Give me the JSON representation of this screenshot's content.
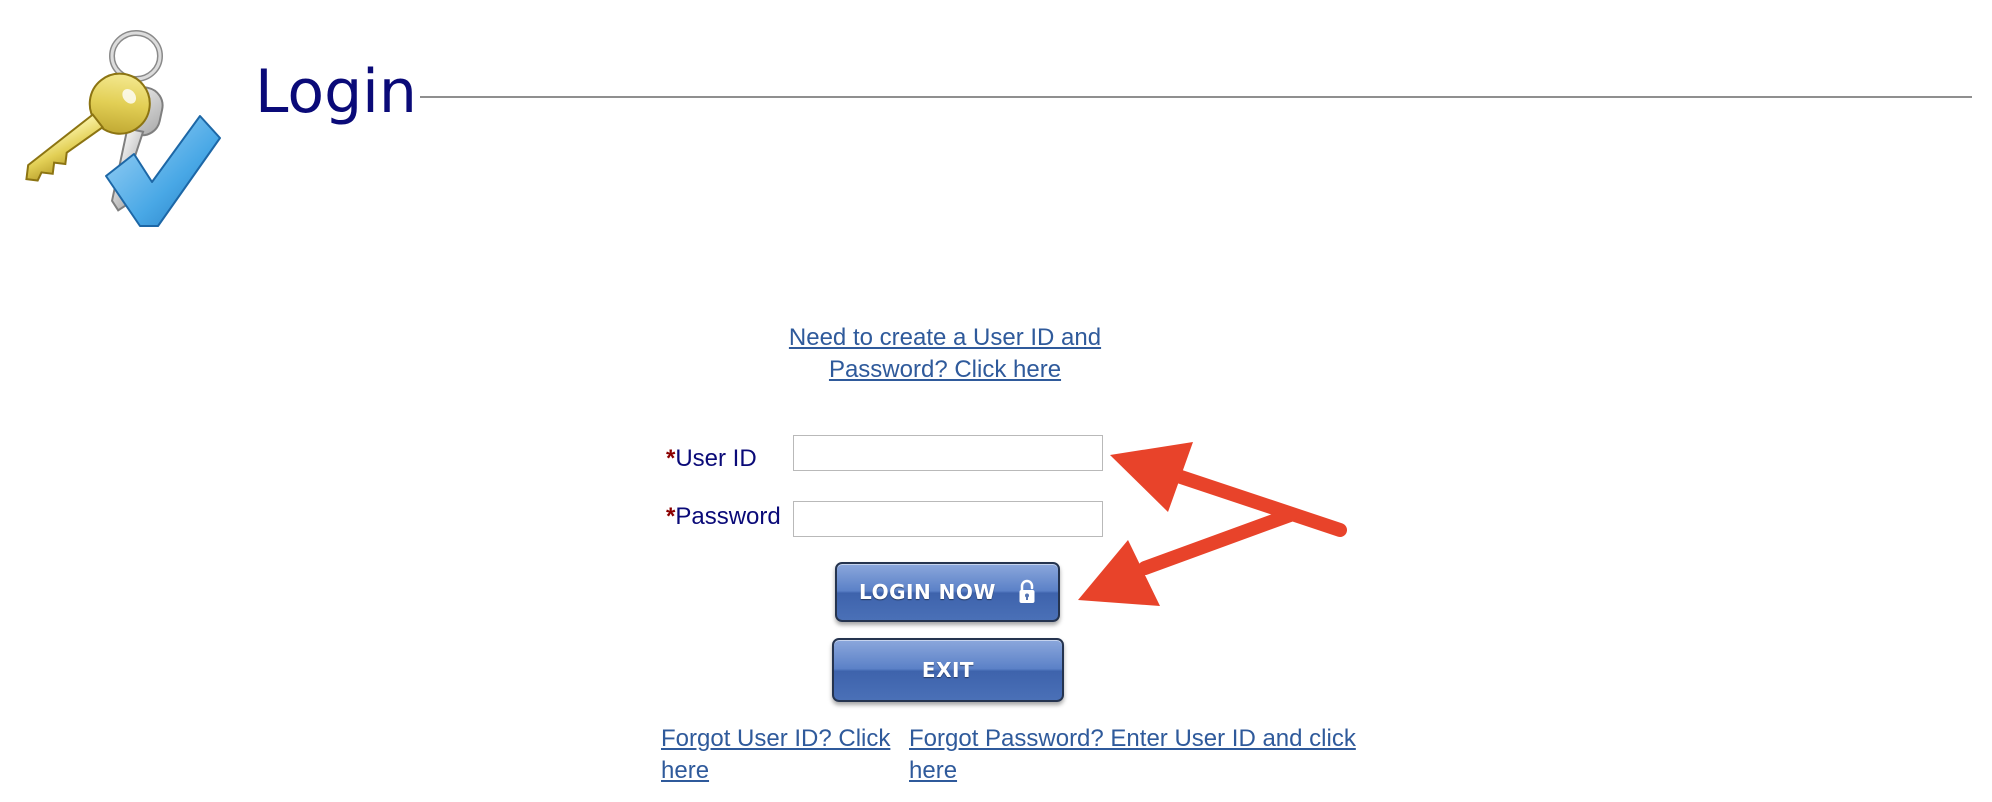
{
  "header": {
    "title": "Login",
    "logo_icon": "keys-checkmark-icon"
  },
  "links": {
    "create_account": "Need to create a User ID and Password? Click here",
    "forgot_userid": "Forgot User ID? Click here",
    "forgot_password": "Forgot Password? Enter User ID and click here"
  },
  "form": {
    "required_marker": "*",
    "userid_label": "User ID",
    "userid_value": "",
    "password_label": "Password",
    "password_value": "",
    "login_button_label": "LOGIN NOW",
    "exit_button_label": "EXIT",
    "login_button_icon": "padlock-icon"
  },
  "annotations": {
    "arrow_color": "#e8432a"
  },
  "colors": {
    "title": "#0a0a78",
    "link": "#2f5a9b",
    "required": "#8b0000",
    "button": "#4a70b7"
  }
}
